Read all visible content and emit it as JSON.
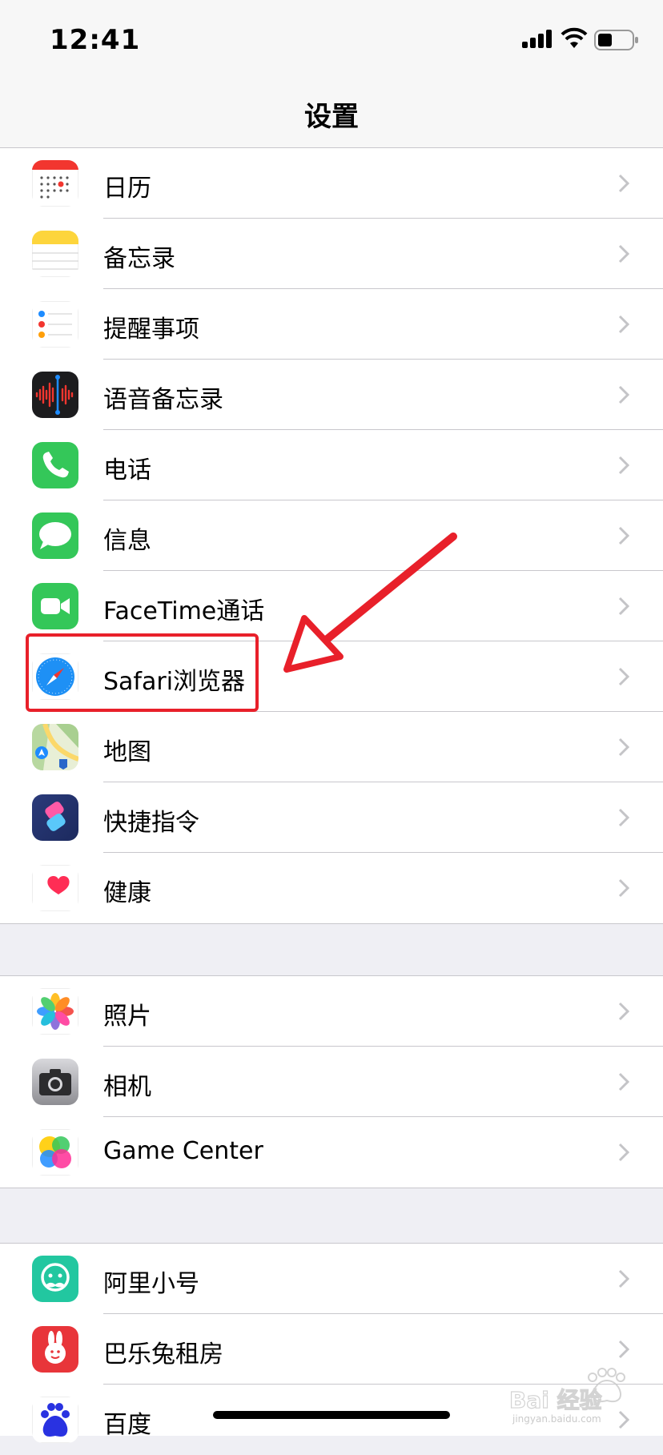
{
  "status_bar": {
    "time": "12:41"
  },
  "nav": {
    "title": "设置"
  },
  "groups": [
    {
      "items": [
        {
          "label": "日历"
        },
        {
          "label": "备忘录"
        },
        {
          "label": "提醒事项"
        },
        {
          "label": "语音备忘录"
        },
        {
          "label": "电话"
        },
        {
          "label": "信息"
        },
        {
          "label": "FaceTime通话"
        },
        {
          "label": "Safari浏览器"
        },
        {
          "label": "地图"
        },
        {
          "label": "快捷指令"
        },
        {
          "label": "健康"
        }
      ]
    },
    {
      "items": [
        {
          "label": "照片"
        },
        {
          "label": "相机"
        },
        {
          "label": "Game Center"
        }
      ]
    },
    {
      "items": [
        {
          "label": "阿里小号"
        },
        {
          "label": "巴乐兔租房"
        },
        {
          "label": "百度"
        }
      ]
    }
  ],
  "watermark": {
    "text": "Baidu经验",
    "subtext": "jingyan.baidu.com"
  },
  "colors": {
    "annotation": "#e8202a",
    "separator": "#c8c7cc",
    "background": "#efeff4"
  }
}
